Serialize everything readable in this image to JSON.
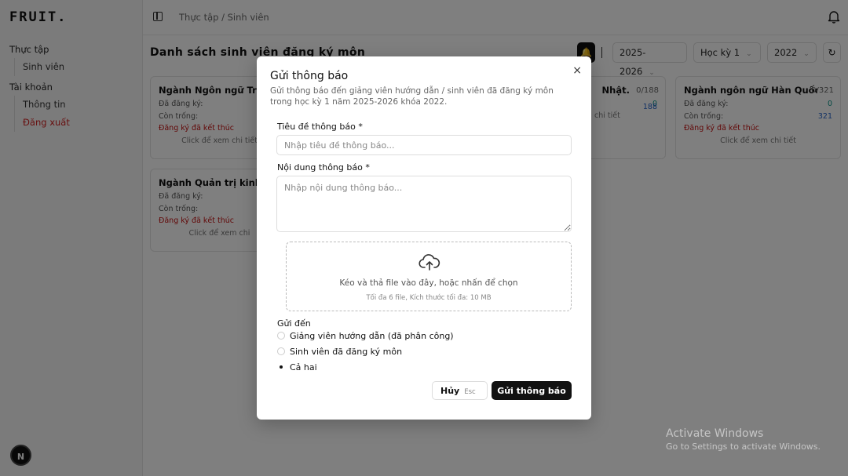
{
  "app": {
    "logo": "FRUIT."
  },
  "sidebar": {
    "group1": "Thực tập",
    "group1_items": [
      "Sinh viên"
    ],
    "group2": "Tài khoản",
    "group2_items": [
      "Thông tin",
      "Đăng xuất"
    ],
    "badge": "N"
  },
  "header": {
    "breadcrumb": "Thực tập / Sinh viên"
  },
  "main": {
    "title": "Danh sách sinh viên đăng ký môn",
    "filters": {
      "year": "2025-2026",
      "semester": "Học kỳ 1",
      "cohort": "2022"
    },
    "cards": [
      {
        "title": "Ngành Ngôn ngữ Trung",
        "count": "",
        "registered_label": "Đã đăng ký:",
        "registered": "",
        "remaining_label": "Còn trống:",
        "remaining": "",
        "status": "Đăng ký đã kết thúc",
        "link": "Click để xem chi tiết"
      },
      {
        "title": "Nhật.",
        "count": "0/188",
        "registered_label": "",
        "registered": "0",
        "remaining_label": "",
        "remaining": "188",
        "status": "",
        "link": "chi tiết"
      },
      {
        "title": "Ngành ngôn ngữ Hàn Quốc",
        "count": "0/321",
        "registered_label": "Đã đăng ký:",
        "registered": "0",
        "remaining_label": "Còn trống:",
        "remaining": "321",
        "status": "Đăng ký đã kết thúc",
        "link": "Click để xem chi tiết"
      },
      {
        "title": "Ngành Quản trị kinh",
        "count": "",
        "registered_label": "Đã đăng ký:",
        "registered": "",
        "remaining_label": "Còn trống:",
        "remaining": "",
        "status": "Đăng ký đã kết thúc",
        "link": "Click để xem chi"
      }
    ]
  },
  "modal": {
    "title": "Gửi thông báo",
    "description": "Gửi thông báo đến giảng viên hướng dẫn / sinh viên đã đăng ký môn trong học kỳ 1 năm 2025-2026 khóa 2022.",
    "subject_label": "Tiêu đề thông báo *",
    "subject_placeholder": "Nhập tiêu đề thông báo...",
    "content_label": "Nội dung thông báo *",
    "content_placeholder": "Nhập nội dung thông báo...",
    "dropzone_main": "Kéo và thả file vào đây, hoặc nhấn để chọn",
    "dropzone_sub": "Tối đa 6 file, Kích thước tối đa: 10 MB",
    "send_to_label": "Gửi đến",
    "options": [
      "Giảng viên hướng dẫn (đã phân công)",
      "Sinh viên đã đăng ký môn",
      "Cả hai"
    ],
    "selected_option": "Cả hai",
    "cancel_label": "Hủy",
    "cancel_kbd": "Esc",
    "submit_label": "Gửi thông báo",
    "close_symbol": "×"
  },
  "os": {
    "activate_title": "Activate Windows",
    "activate_sub": "Go to Settings to activate Windows."
  }
}
